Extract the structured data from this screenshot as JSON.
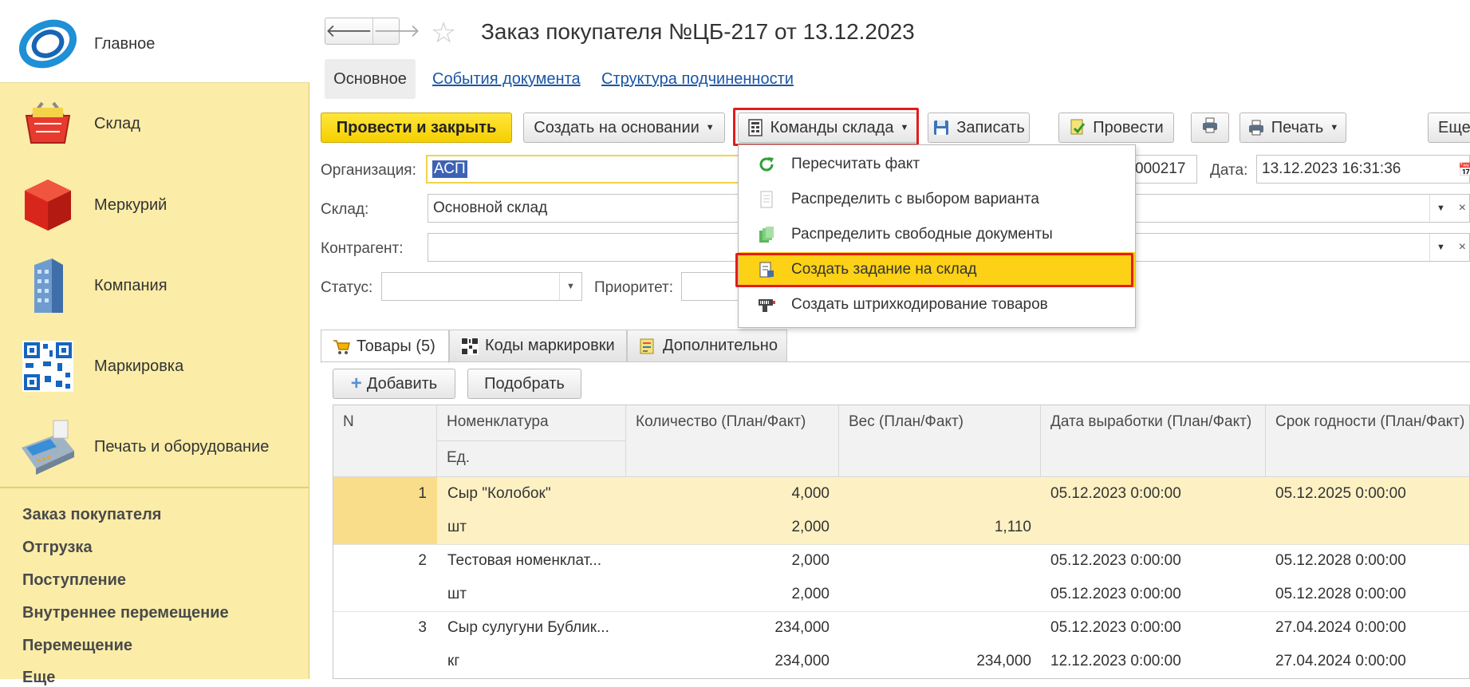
{
  "sidebar": {
    "items": [
      {
        "label": "Главное",
        "icon": "main-logo-icon"
      },
      {
        "label": "Склад",
        "icon": "basket-icon"
      },
      {
        "label": "Меркурий",
        "icon": "red-cube-icon"
      },
      {
        "label": "Компания",
        "icon": "building-icon"
      },
      {
        "label": "Маркировка",
        "icon": "qr-code-icon"
      },
      {
        "label": "Печать и оборудование",
        "icon": "pos-terminal-icon"
      }
    ],
    "links": [
      "Заказ покупателя",
      "Отгрузка",
      "Поступление",
      "Внутреннее перемещение",
      "Перемещение",
      "Еще"
    ]
  },
  "header": {
    "title": "Заказ покупателя №ЦБ-217 от 13.12.2023",
    "tabs": [
      "Основное",
      "События документа",
      "Структура подчиненности"
    ]
  },
  "toolbar": {
    "post_close": "Провести и закрыть",
    "create_based": "Создать на основании",
    "warehouse_cmds": "Команды склада",
    "save": "Записать",
    "post": "Провести",
    "print": "Печать",
    "more": "Еще"
  },
  "menu": {
    "items": [
      {
        "label": "Пересчитать факт",
        "icon": "refresh-icon"
      },
      {
        "label": "Распределить с выбором варианта",
        "icon": "document-icon"
      },
      {
        "label": "Распределить свободные документы",
        "icon": "documents-green-icon"
      },
      {
        "label": "Создать задание на склад",
        "icon": "task-icon",
        "active": true
      },
      {
        "label": "Создать штрихкодирование товаров",
        "icon": "barcode-gun-icon"
      }
    ]
  },
  "form": {
    "org_label": "Организация:",
    "org_value": "АСП",
    "number_suffix": "000217",
    "date_label": "Дата:",
    "date_value": "13.12.2023 16:31:36",
    "warehouse_label": "Склад:",
    "warehouse_value": "Основной склад",
    "counterparty_label": "Контрагент:",
    "counterparty_value": "",
    "status_label": "Статус:",
    "status_value": "",
    "priority_label": "Приоритет:"
  },
  "tabs": {
    "goods": "Товары (5)",
    "marking": "Коды маркировки",
    "additional": "Дополнительно"
  },
  "table_actions": {
    "add": "Добавить",
    "pick": "Подобрать"
  },
  "table": {
    "headers": {
      "n": "N",
      "item": "Номенклатура",
      "unit": "Ед.",
      "qty": "Количество (План/Факт)",
      "weight": "Вес (План/Факт)",
      "prod_date": "Дата выработки (План/Факт)",
      "expiry": "Срок годности (План/Факт)"
    },
    "rows": [
      {
        "n": "1",
        "item": "Сыр \"Колобок\"",
        "unit": "шт",
        "qty_plan": "4,000",
        "qty_fact": "2,000",
        "weight_plan": "",
        "weight_fact": "1,110",
        "prod_plan": "05.12.2023 0:00:00",
        "prod_fact": "",
        "exp_plan": "05.12.2025 0:00:00",
        "exp_fact": ""
      },
      {
        "n": "2",
        "item": "Тестовая номенклат...",
        "unit": "шт",
        "qty_plan": "2,000",
        "qty_fact": "2,000",
        "weight_plan": "",
        "weight_fact": "",
        "prod_plan": "05.12.2023 0:00:00",
        "prod_fact": "05.12.2023 0:00:00",
        "exp_plan": "05.12.2028 0:00:00",
        "exp_fact": "05.12.2028 0:00:00"
      },
      {
        "n": "3",
        "item": "Сыр сулугуни Бублик...",
        "unit": "кг",
        "qty_plan": "234,000",
        "qty_fact": "234,000",
        "weight_plan": "",
        "weight_fact": "234,000",
        "prod_plan": "05.12.2023 0:00:00",
        "prod_fact": "12.12.2023 0:00:00",
        "exp_plan": "27.04.2024 0:00:00",
        "exp_fact": "27.04.2024 0:00:00"
      }
    ]
  },
  "colors": {
    "sidebar_bg": "#fbeca7",
    "primary_button": "#f5cf00",
    "highlight_border": "#e51b1b",
    "link": "#1a55a6",
    "active_menu": "#fcd116"
  }
}
